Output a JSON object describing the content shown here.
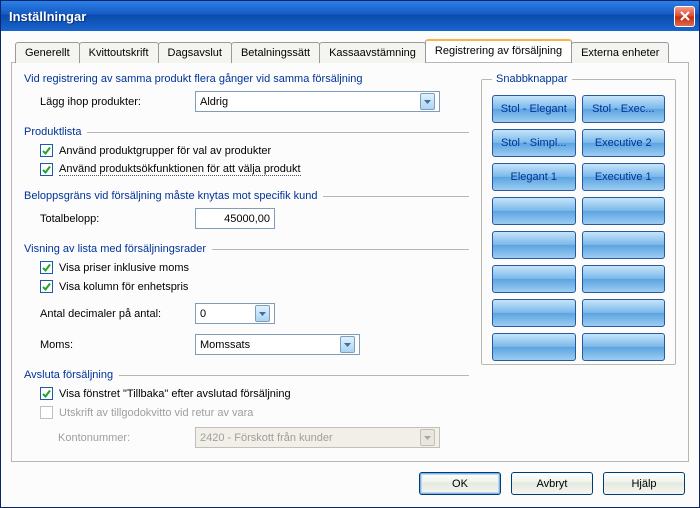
{
  "window": {
    "title": "Inställningar"
  },
  "tabs": [
    {
      "label": "Generellt"
    },
    {
      "label": "Kvittoutskrift"
    },
    {
      "label": "Dagsavslut"
    },
    {
      "label": "Betalningssätt"
    },
    {
      "label": "Kassaavstämning"
    },
    {
      "label": "Registrering av försäljning"
    },
    {
      "label": "Externa enheter"
    }
  ],
  "active_tab": 5,
  "sec_reg": {
    "title": "Vid registrering av samma produkt flera gånger vid samma försäljning",
    "combine_label": "Lägg ihop produkter:",
    "combine_value": "Aldrig"
  },
  "sec_prodlist": {
    "title": "Produktlista",
    "cb_groups": "Använd produktgrupper för val av produkter",
    "cb_search": "Använd produktsökfunktionen för att välja produkt"
  },
  "sec_limit": {
    "title": "Beloppsgräns vid försäljning måste knytas mot specifik kund",
    "total_label": "Totalbelopp:",
    "total_value": "45000,00"
  },
  "sec_view": {
    "title": "Visning av lista med försäljningsrader",
    "cb_incvat": "Visa priser inklusive moms",
    "cb_unitprice": "Visa kolumn för enhetspris",
    "decimals_label": "Antal decimaler på antal:",
    "decimals_value": "0",
    "vat_label": "Moms:",
    "vat_value": "Momssats"
  },
  "sec_end": {
    "title": "Avsluta försäljning",
    "cb_backwin": "Visa fönstret \"Tillbaka\" efter avslutad försäljning",
    "cb_credit": "Utskrift av tillgodokvitto vid retur av vara",
    "acct_label": "Kontonummer:",
    "acct_value": "2420 - Förskott från kunder"
  },
  "quick": {
    "title": "Snabbknappar",
    "buttons": [
      "Stol - Elegant",
      "Stol - Exec...",
      "Stol - Simpl...",
      "Executive 2",
      "Elegant 1",
      "Executive 1",
      "",
      "",
      "",
      "",
      "",
      "",
      "",
      "",
      "",
      ""
    ]
  },
  "buttons": {
    "ok": "OK",
    "cancel": "Avbryt",
    "help": "Hjälp"
  }
}
